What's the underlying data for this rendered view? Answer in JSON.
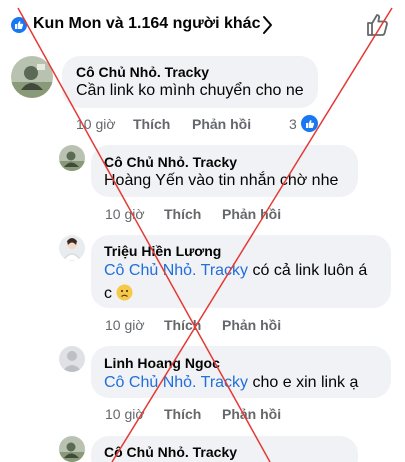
{
  "header": {
    "reactors_text": "Kun Mon và 1.164 người khác",
    "reaction_icon": "like-icon",
    "chevron_icon": "chevron-right-icon",
    "like_button_icon": "thumbs-up-outline-icon",
    "accent_color": "#1877f2"
  },
  "comments": [
    {
      "author": "Cô Chủ Nhỏ. Tracky",
      "text": "Cần link ko mình chuyển cho ne",
      "time": "10 giờ",
      "like_label": "Thích",
      "reply_label": "Phản hồi",
      "reaction_count": "3"
    },
    {
      "author": "Cô Chủ Nhỏ. Tracky",
      "text": "Hoàng Yến vào tin nhắn  chờ nhe",
      "time": "10 giờ",
      "like_label": "Thích",
      "reply_label": "Phản hồi"
    },
    {
      "author": "Triệu Hiền Lương",
      "mention": "Cô Chủ Nhỏ. Tracky",
      "text_line1": " có cả link luôn á",
      "text_line2": "c",
      "emoji": "worried-face-emoji",
      "time": "10 giờ",
      "like_label": "Thích",
      "reply_label": "Phản hồi"
    },
    {
      "author": "Linh Hoang Ngoc",
      "mention": "Cô Chủ Nhỏ. Tracky",
      "text": " cho e xin link ạ",
      "time": "10 giờ",
      "like_label": "Thích",
      "reply_label": "Phản hồi"
    },
    {
      "author": "Cô Chủ Nhỏ. Tracky"
    }
  ],
  "overlay": {
    "cross_color": "#e53935"
  }
}
